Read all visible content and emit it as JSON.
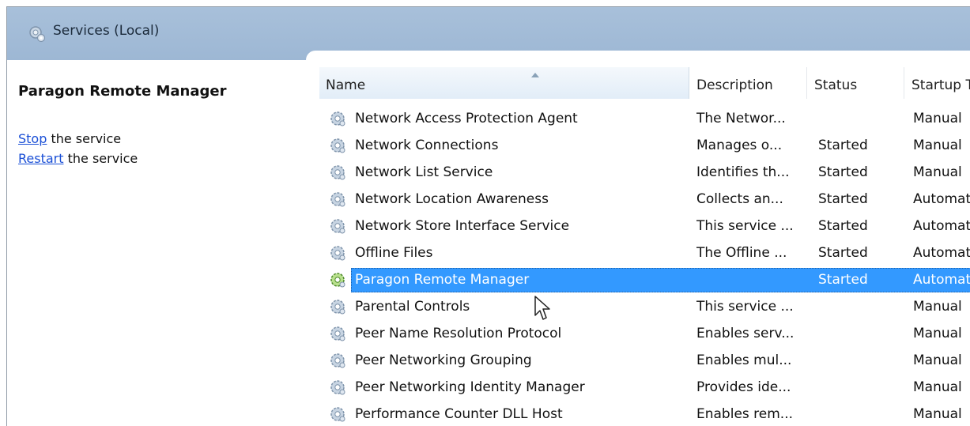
{
  "window": {
    "title": "Services (Local)"
  },
  "left_pane": {
    "service_name": "Paragon Remote Manager",
    "actions": [
      {
        "link": "Stop",
        "rest": " the service"
      },
      {
        "link": "Restart",
        "rest": " the service"
      }
    ]
  },
  "columns": {
    "name": "Name",
    "description": "Description",
    "status": "Status",
    "startup": "Startup Type"
  },
  "services": [
    {
      "name": "Network Access Protection Agent",
      "description": "The Networ...",
      "status": "",
      "startup": "Manual"
    },
    {
      "name": "Network Connections",
      "description": "Manages o...",
      "status": "Started",
      "startup": "Manual"
    },
    {
      "name": "Network List Service",
      "description": "Identifies th...",
      "status": "Started",
      "startup": "Manual"
    },
    {
      "name": "Network Location Awareness",
      "description": "Collects an...",
      "status": "Started",
      "startup": "Automatic"
    },
    {
      "name": "Network Store Interface Service",
      "description": "This service ...",
      "status": "Started",
      "startup": "Automatic"
    },
    {
      "name": "Offline Files",
      "description": "The Offline ...",
      "status": "Started",
      "startup": "Automatic"
    },
    {
      "name": "Paragon Remote Manager",
      "description": "",
      "status": "Started",
      "startup": "Automatic",
      "selected": true
    },
    {
      "name": "Parental Controls",
      "description": "This service ...",
      "status": "",
      "startup": "Manual"
    },
    {
      "name": "Peer Name Resolution Protocol",
      "description": "Enables serv...",
      "status": "",
      "startup": "Manual"
    },
    {
      "name": "Peer Networking Grouping",
      "description": "Enables mul...",
      "status": "",
      "startup": "Manual"
    },
    {
      "name": "Peer Networking Identity Manager",
      "description": "Provides ide...",
      "status": "",
      "startup": "Manual"
    },
    {
      "name": "Performance Counter DLL Host",
      "description": "Enables rem...",
      "status": "",
      "startup": "Manual"
    }
  ],
  "icons": {
    "title": "services-gears-icon",
    "row": "service-gear-icon",
    "cursor": "mouse-pointer-icon"
  },
  "colors": {
    "title_bar": "#a3bcd8",
    "selection": "#3399ff",
    "link": "#1a4fd6"
  }
}
